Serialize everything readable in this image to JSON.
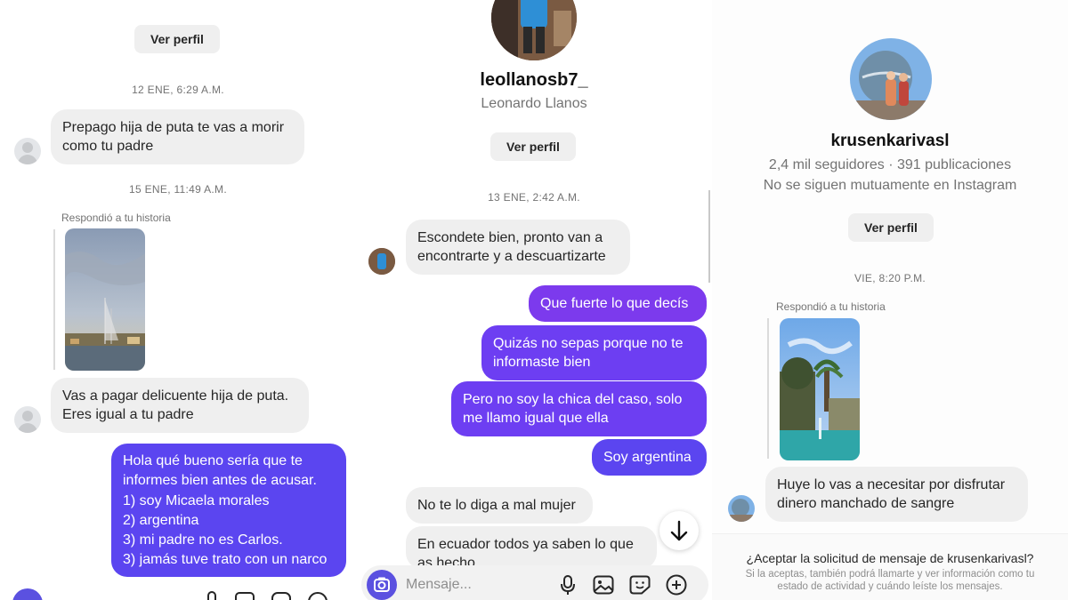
{
  "panel1": {
    "ver_perfil": "Ver perfil",
    "timestamp1": "12 ENE, 6:29 A.M.",
    "msg1": "Prepago hija de puta te vas a morir como tu padre",
    "timestamp2": "15 ENE, 11:49 A.M.",
    "story_reply_label": "Respondió a tu historia",
    "msg2": "Vas a pagar delicuente hija de puta. Eres igual a tu padre",
    "reply_lines": [
      "Hola qué bueno sería que te",
      "informes bien antes de acusar.",
      "1) soy Micaela morales",
      "2) argentina",
      "3) mi padre no es Carlos.",
      "3) jamás tuve trato con un narco"
    ]
  },
  "panel2": {
    "username": "leollanosb7_",
    "full_name": "Leonardo Llanos",
    "ver_perfil": "Ver perfil",
    "timestamp": "13 ENE, 2:42 A.M.",
    "msg_in1": "Escondete bien, pronto van a encontrarte y a descuartizarte",
    "out1": "Que fuerte lo que decís",
    "out2": "Quizás no sepas porque no te informaste bien",
    "out3": "Pero no soy la chica del caso, solo me llamo igual que ella",
    "out4": "Soy argentina",
    "msg_in2": "No te lo diga a mal mujer",
    "msg_in3": "En ecuador todos ya saben lo que as hecho",
    "composer_placeholder": "Mensaje..."
  },
  "panel3": {
    "username": "krusenkarivasl",
    "stats": "2,4 mil seguidores · 391 publicaciones",
    "mutual": "No se siguen mutuamente en Instagram",
    "ver_perfil": "Ver perfil",
    "timestamp": "VIE, 8:20 P.M.",
    "story_reply_label": "Respondió a tu historia",
    "msg": "Huye lo vas a necesitar por disfrutar dinero manchado de sangre",
    "request_title": "¿Aceptar la solicitud de mensaje de krusenkarivasl?",
    "request_body": "Si la aceptas, también podrá llamarte y ver información como tu estado de actividad y cuándo leíste los mensajes."
  },
  "colors": {
    "outgoing_bubble": "#7c3aed",
    "incoming_bubble": "#efefef",
    "button_bg": "#efefef",
    "muted_text": "#737373"
  },
  "icons": [
    "camera-icon",
    "microphone-icon",
    "gallery-icon",
    "sticker-icon",
    "plus-icon",
    "arrow-down-icon"
  ]
}
